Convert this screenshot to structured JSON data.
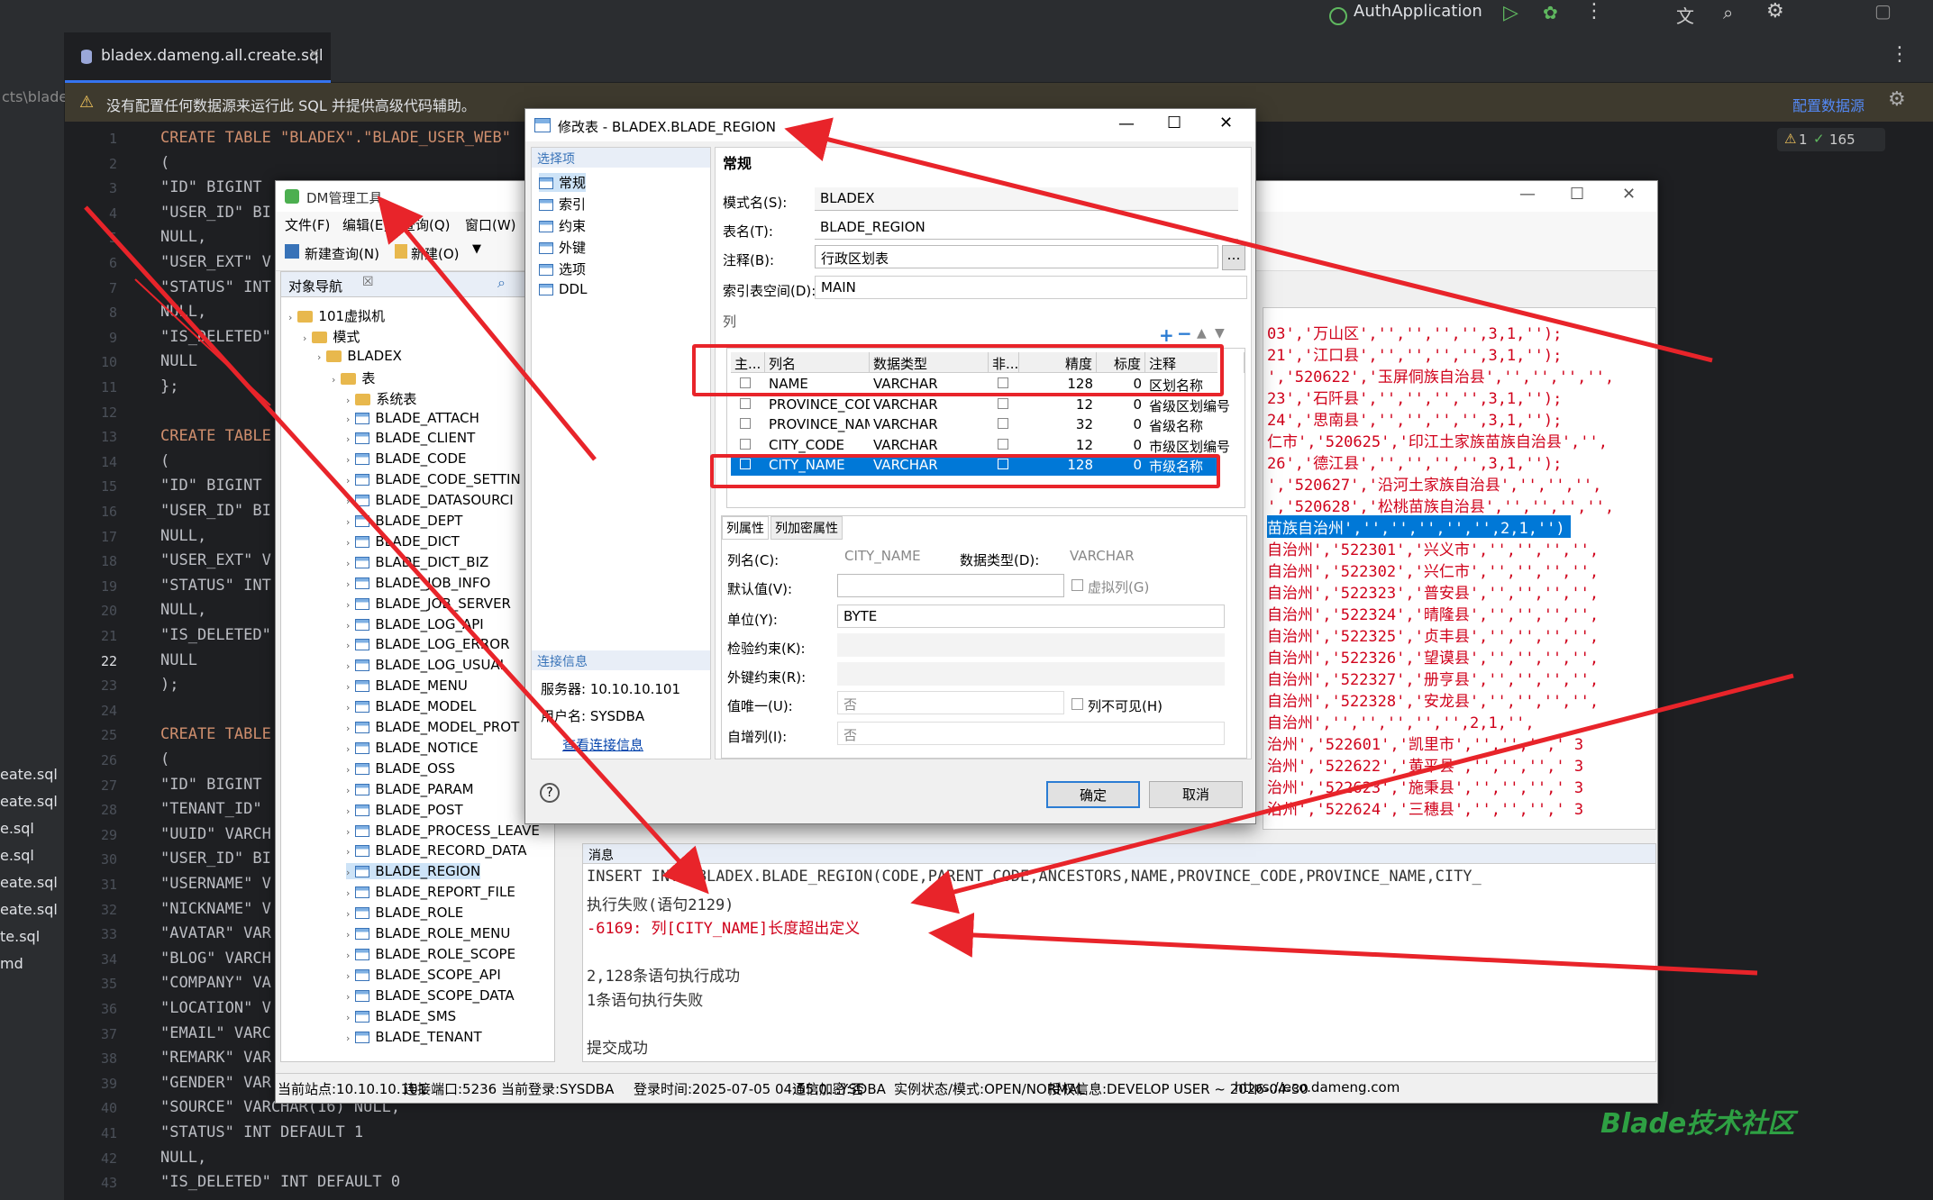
{
  "ide": {
    "app_name": "AuthApplication",
    "file_tab": "bladex.dameng.all.create.sql",
    "path_fragment": "cts\\blade",
    "warning": "没有配置任何数据源来运行此 SQL 并提供高级代码辅助。",
    "config_link": "配置数据源",
    "inspection_warn": "1",
    "inspection_ok": "165",
    "line_numbers": [
      "1",
      "2",
      "3",
      "4",
      "5",
      "6",
      "7",
      "8",
      "9",
      "10",
      "11",
      "12",
      "13",
      "14",
      "15",
      "16",
      "17",
      "18",
      "19",
      "20",
      "21",
      "22",
      "23",
      "24",
      "25",
      "26",
      "27",
      "28",
      "29",
      "30",
      "31",
      "32",
      "33",
      "34",
      "35",
      "36",
      "37",
      "38",
      "39",
      "40",
      "41",
      "42",
      "43"
    ],
    "code_lines": [
      "CREATE TABLE \"BLADEX\".\"BLADE_USER_WEB\"",
      "(",
      "\"ID\" BIGINT",
      "\"USER_ID\" BI",
      "NULL,",
      "\"USER_EXT\" V",
      "\"STATUS\" INT",
      "NULL,",
      "\"IS_DELETED\"",
      "NULL",
      "};",
      "",
      "CREATE TABLE",
      "(",
      "\"ID\" BIGINT",
      "\"USER_ID\" BI",
      "NULL,",
      "\"USER_EXT\" V",
      "\"STATUS\" INT",
      "NULL,",
      "\"IS_DELETED\"",
      "NULL",
      ");",
      "",
      "CREATE TABLE",
      "(",
      "\"ID\" BIGINT",
      "\"TENANT_ID\"",
      "\"UUID\" VARCH",
      "\"USER_ID\" BI",
      "\"USERNAME\" V",
      "\"NICKNAME\" V",
      "\"AVATAR\" VAR",
      "\"BLOG\" VARCH",
      "\"COMPANY\" VA",
      "\"LOCATION\" V",
      "\"EMAIL\" VARC",
      "\"REMARK\" VAR",
      "\"GENDER\" VAR",
      "\"SOURCE\" VARCHAR(16) NULL,",
      "\"STATUS\" INT DEFAULT 1",
      "NULL,",
      "\"IS_DELETED\" INT DEFAULT 0"
    ],
    "side_files": [
      "eate.sql",
      "eate.sql",
      "e.sql",
      "e.sql",
      "eate.sql",
      "eate.sql",
      "te.sql",
      "md"
    ]
  },
  "dm": {
    "title": "DM管理工具",
    "menu": [
      "文件(F)",
      "编辑(E)",
      "查询(Q)",
      "窗口(W)"
    ],
    "new_query": "新建查询(N)",
    "new": "新建(O)",
    "nav_title": "对象导航",
    "tree": [
      "101虚拟机",
      "模式",
      "BLADEX",
      "表",
      "系统表",
      "BLADE_ATTACH",
      "BLADE_CLIENT",
      "BLADE_CODE",
      "BLADE_CODE_SETTIN",
      "BLADE_DATASOURCI",
      "BLADE_DEPT",
      "BLADE_DICT",
      "BLADE_DICT_BIZ",
      "BLADE_JOB_INFO",
      "BLADE_JOB_SERVER",
      "BLADE_LOG_API",
      "BLADE_LOG_ERROR",
      "BLADE_LOG_USUAL",
      "BLADE_MENU",
      "BLADE_MODEL",
      "BLADE_MODEL_PROT",
      "BLADE_NOTICE",
      "BLADE_OSS",
      "BLADE_PARAM",
      "BLADE_POST",
      "BLADE_PROCESS_LEAVE",
      "BLADE_RECORD_DATA",
      "BLADE_REGION",
      "BLADE_REPORT_FILE",
      "BLADE_ROLE",
      "BLADE_ROLE_MENU",
      "BLADE_ROLE_SCOPE",
      "BLADE_SCOPE_API",
      "BLADE_SCOPE_DATA",
      "BLADE_SMS",
      "BLADE_TENANT"
    ],
    "data_lines": [
      "03','万山区','','','','',3,1,'');",
      "21','江口县','','','','',3,1,'');",
      "','520622','玉屏侗族自治县','','','','',",
      "23','石阡县','','','','',3,1,'');",
      "24','思南县','','','','',3,1,'');",
      "仁市','520625','印江土家族苗族自治县','',",
      "26','德江县','','','','',3,1,'');",
      "','520627','沿河土家族自治县','','','',",
      "','520628','松桃苗族自治县','','','','',",
      "苗族自治州','','','','','',2,1,'')",
      "自治州','522301','兴义市','','','','',",
      "自治州','522302','兴仁市','','','','',",
      "自治州','522323','普安县','','','','',",
      "自治州','522324','晴隆县','','','','',",
      "自治州','522325','贞丰县','','','','',",
      "自治州','522326','望谟县','','','','',",
      "自治州','522327','册亨县','','','','',",
      "自治州','522328','安龙县','','','','',",
      "自治州','','','','','',2,1,'',",
      "治州','522601','凯里市','','','',' 3",
      "治州','522622','黄平县','','','',' 3",
      "治州','522623','施秉县','','','',' 3",
      "治州','522624','三穗县','','','',' 3"
    ],
    "msg_title": "消息",
    "messages": [
      "INSERT INTO BLADEX.BLADE_REGION(CODE,PARENT_CODE,ANCESTORS,NAME,PROVINCE_CODE,PROVINCE_NAME,CITY_",
      "执行失败(语句2129)",
      "-6169: 列[CITY_NAME]长度超出定义",
      "",
      "2,128条语句执行成功",
      "1条语句执行失败",
      "",
      "提交成功"
    ],
    "status": [
      "当前站点:10.10.10.101",
      "连接端口:5236",
      "当前登录:SYSDBA",
      "登录时间:2025-07-05 04:55:0...YSDBA",
      "通信加密:否",
      "实例状态/模式:OPEN/NORMAL",
      "授权信息:DEVELOP USER ~ 2026-04-30",
      "https://eco.dameng.com"
    ]
  },
  "modal": {
    "title": "修改表 - BLADEX.BLADE_REGION",
    "select_section": "选择项",
    "nav": [
      "常规",
      "索引",
      "约束",
      "外键",
      "选项",
      "DDL"
    ],
    "conn_section": "连接信息",
    "server": "服务器: 10.10.10.101",
    "user": "用户名: SYSDBA",
    "view_conn": "查看连接信息",
    "section": "常规",
    "schema_label": "模式名(S):",
    "schema": "BLADEX",
    "table_label": "表名(T):",
    "table": "BLADE_REGION",
    "comment_label": "注释(B):",
    "comment": "行政区划表",
    "ts_label": "索引表空间(D):",
    "ts": "MAIN",
    "cols_label": "列",
    "grid_headers": [
      "主...",
      "列名",
      "数据类型",
      "非...",
      "精度",
      "标度",
      "注释"
    ],
    "grid_rows": [
      [
        "NAME",
        "VARCHAR",
        "128",
        "0",
        "区划名称"
      ],
      [
        "PROVINCE_COD",
        "VARCHAR",
        "12",
        "0",
        "省级区划编号"
      ],
      [
        "PROVINCE_NAM",
        "VARCHAR",
        "32",
        "0",
        "省级名称"
      ],
      [
        "CITY_CODE",
        "VARCHAR",
        "12",
        "0",
        "市级区划编号"
      ],
      [
        "CITY_NAME",
        "VARCHAR",
        "128",
        "0",
        "市级名称"
      ]
    ],
    "prop_tabs": [
      "列属性",
      "列加密属性"
    ],
    "colname_label": "列名(C):",
    "colname": "CITY_NAME",
    "dtype_label": "数据类型(D):",
    "dtype": "VARCHAR",
    "default_label": "默认值(V):",
    "virtual": "虚拟列(G)",
    "unit_label": "单位(Y):",
    "unit": "BYTE",
    "check_label": "检验约束(K):",
    "fk_label": "外键约束(R):",
    "unique_label": "值唯一(U):",
    "unique": "否",
    "invisible": "列不可见(H)",
    "identity_label": "自增列(I):",
    "identity": "否",
    "ok": "确定",
    "cancel": "取消"
  },
  "watermark": "Blade技术社区",
  "colors": {
    "accent": "#e8242a",
    "selection": "#0078d7"
  }
}
